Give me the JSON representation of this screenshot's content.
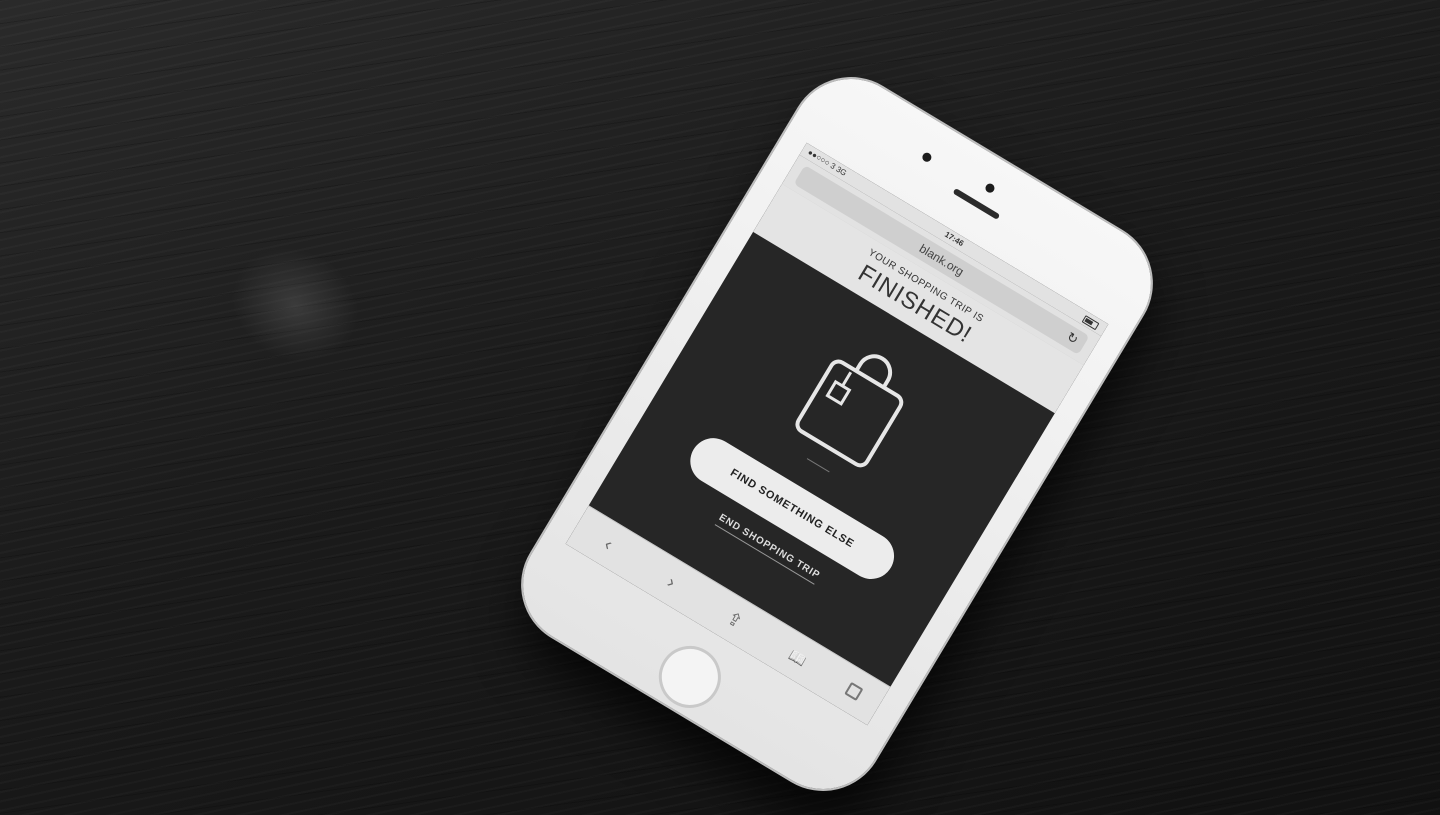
{
  "statusbar": {
    "carrier": "●●○○○ 3  3G",
    "time": "17:46"
  },
  "browser": {
    "url": "blank.org",
    "reload_icon": "↻"
  },
  "page": {
    "subtitle": "YOUR SHOPPING TRIP IS",
    "title": "FINISHED!",
    "primary_button": "FIND SOMETHING ELSE",
    "secondary_link": "END SHOPPING TRIP"
  },
  "toolbar": {
    "back": "‹",
    "forward": "›",
    "share": "⇪",
    "bookmarks": "📖"
  },
  "icons": [
    "shopping-bag-icon",
    "reload-icon",
    "back-icon",
    "forward-icon",
    "share-icon",
    "bookmarks-icon",
    "tabs-icon",
    "battery-icon"
  ]
}
